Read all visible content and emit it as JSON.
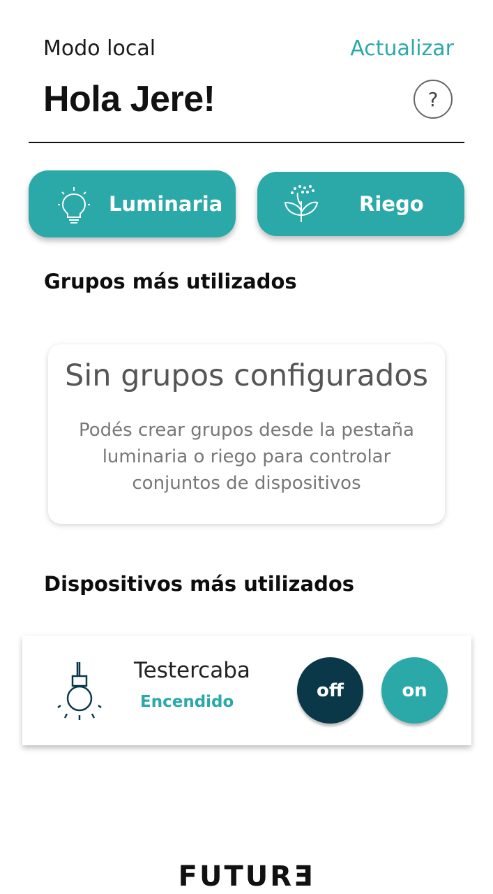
{
  "header": {
    "mode_label": "Modo local",
    "refresh_label": "Actualizar",
    "greeting": "Hola Jere!",
    "help_symbol": "?"
  },
  "categories": {
    "luminaria": {
      "label": "Luminaria",
      "icon": "lightbulb-icon"
    },
    "riego": {
      "label": "Riego",
      "icon": "plant-sprinkle-icon"
    }
  },
  "groups": {
    "title": "Grupos más utilizados",
    "empty_title": "Sin grupos configurados",
    "empty_description": "Podés crear grupos desde la pestaña luminaria o riego para controlar conjuntos de dispositivos"
  },
  "devices": {
    "title": "Dispositivos más utilizados",
    "items": [
      {
        "name": "Testercaba",
        "status": "Encendido",
        "icon": "hanging-bulb-icon",
        "off_label": "off",
        "on_label": "on"
      }
    ]
  },
  "footer": {
    "brand": "FUTURƎ"
  },
  "colors": {
    "accent": "#2aa9a8",
    "dark": "#0a3849"
  }
}
